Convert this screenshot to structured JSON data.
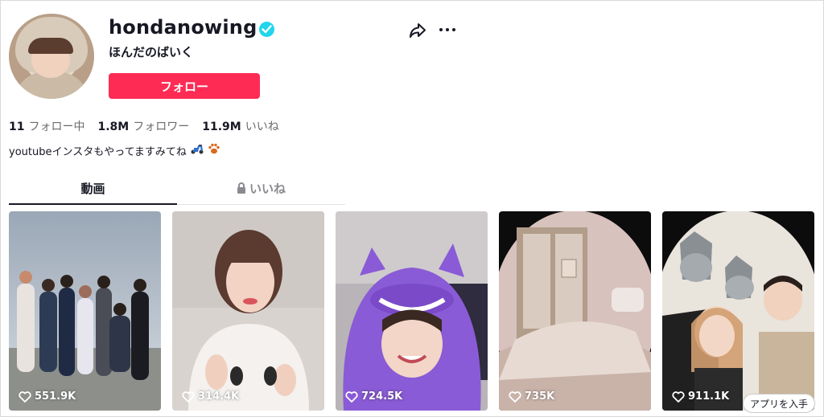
{
  "profile": {
    "username": "hondanowing",
    "nickname": "ほんだのばいく",
    "follow_label": "フォロー",
    "bio": "youtubeインスタもやってますみてね",
    "bio_emojis": [
      "scooter-icon",
      "paw-icon"
    ]
  },
  "stats": [
    {
      "value": "11",
      "label": "フォロー中"
    },
    {
      "value": "1.8M",
      "label": "フォロワー"
    },
    {
      "value": "11.9M",
      "label": "いいね"
    }
  ],
  "tabs": {
    "videos": "動画",
    "liked": "いいね"
  },
  "videos": [
    {
      "likes": "551.9K"
    },
    {
      "likes": "314.4K"
    },
    {
      "likes": "724.5K"
    },
    {
      "likes": "735K"
    },
    {
      "likes": "911.1K"
    }
  ],
  "get_app_label": "アプリを入手",
  "colors": {
    "accent": "#fe2c55",
    "verified": "#20d5ec",
    "text": "#161823",
    "secondary_text": "#8a8b91"
  }
}
